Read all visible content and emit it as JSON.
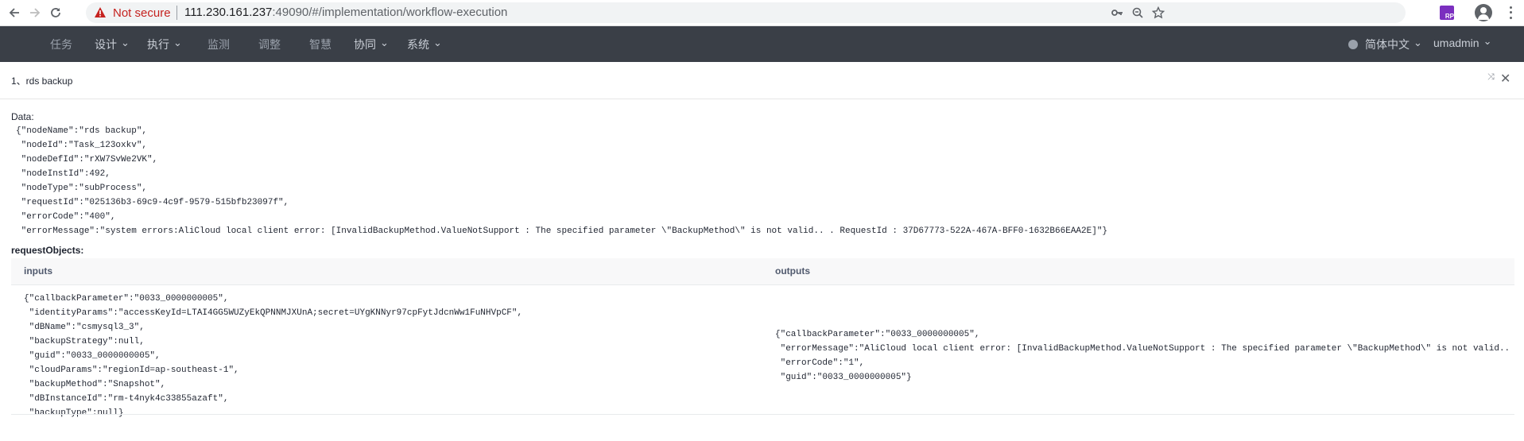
{
  "browser": {
    "security_label": "Not secure",
    "url_host": "111.230.161.237",
    "url_rest": ":49090/#/implementation/workflow-execution"
  },
  "nav": {
    "items": [
      {
        "label": "任务",
        "dropdown": false
      },
      {
        "label": "设计",
        "dropdown": true
      },
      {
        "label": "执行",
        "dropdown": true
      },
      {
        "label": "监测",
        "dropdown": false
      },
      {
        "label": "调整",
        "dropdown": false
      },
      {
        "label": "智慧",
        "dropdown": false
      },
      {
        "label": "协同",
        "dropdown": true
      },
      {
        "label": "系统",
        "dropdown": true
      }
    ],
    "language": "简体中文",
    "user": "umadmin"
  },
  "panel": {
    "title": "1、rds backup",
    "data_label": "Data:",
    "data_json": "{\"nodeName\":\"rds backup\",\n \"nodeId\":\"Task_123oxkv\",\n \"nodeDefId\":\"rXW7SvWe2VK\",\n \"nodeInstId\":492,\n \"nodeType\":\"subProcess\",\n \"requestId\":\"025136b3-69c9-4c9f-9579-515bfb23097f\",\n \"errorCode\":\"400\",\n \"errorMessage\":\"system errors:AliCloud local client error: [InvalidBackupMethod.ValueNotSupport : The specified parameter \\\"BackupMethod\\\" is not valid.. . RequestId : 37D67773-522A-467A-BFF0-1632B66EAA2E]\"}",
    "request_objects_label": "requestObjects:",
    "columns": [
      "inputs",
      "outputs"
    ],
    "inputs_json": "{\"callbackParameter\":\"0033_0000000005\",\n \"identityParams\":\"accessKeyId=LTAI4GG5WUZyEkQPNNMJXUnA;secret=UYgKNNyr97cpFytJdcnWw1FuNHVpCF\",\n \"dBName\":\"csmysql3_3\",\n \"backupStrategy\":null,\n \"guid\":\"0033_0000000005\",\n \"cloudParams\":\"regionId=ap-southeast-1\",\n \"backupMethod\":\"Snapshot\",\n \"dBInstanceId\":\"rm-t4nyk4c33855azaft\",\n \"backupType\":null}",
    "outputs_json": "{\"callbackParameter\":\"0033_0000000005\",\n \"errorMessage\":\"AliCloud local client error: [InvalidBackupMethod.ValueNotSupport : The specified parameter \\\"BackupMethod\\\" is not valid.. . RequestId : 37D67773-522A-467A-BFF0-1632B66EAA2E]\",\n \"errorCode\":\"1\",\n \"guid\":\"0033_0000000005\"}"
  },
  "icons": [
    "back-arrow-icon",
    "forward-arrow-icon",
    "reload-icon",
    "warning-icon",
    "key-icon",
    "zoom-icon",
    "star-icon",
    "rp-extension-icon",
    "account-icon",
    "menu-icon",
    "language-dot-icon",
    "minimize-icon",
    "close-icon"
  ]
}
